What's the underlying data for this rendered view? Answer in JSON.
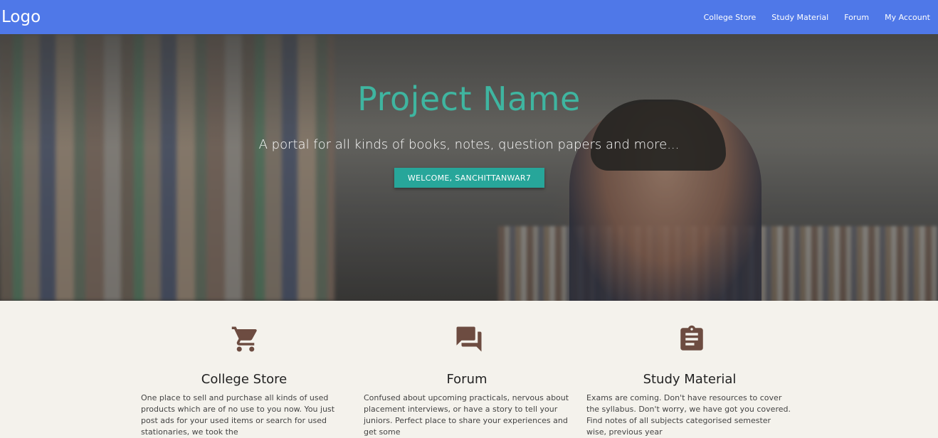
{
  "nav": {
    "logo": "Logo",
    "links": [
      "College Store",
      "Study Material",
      "Forum",
      "My Account"
    ]
  },
  "hero": {
    "title": "Project Name",
    "subtitle": "A portal for all kinds of books, notes, question papers and more...",
    "button": "WELCOME, SANCHITTANWAR7"
  },
  "features": [
    {
      "icon": "shopping-cart-icon",
      "title": "College Store",
      "text": "One place to sell and purchase all kinds of used products which are of no use to you now. You just post ads for your used items or search for used stationaries, we took the"
    },
    {
      "icon": "forum-chat-icon",
      "title": "Forum",
      "text": "Confused about upcoming practicals, nervous about placement interviews, or have a story to tell your juniors. Perfect place to share your experiences and get some"
    },
    {
      "icon": "clipboard-icon",
      "title": "Study Material",
      "text": "Exams are coming. Don't have resources to cover the syllabus. Don't worry, we have got you covered. Find notes of all subjects categorised semester wise, previous year"
    }
  ],
  "colors": {
    "navbar": "#4f78e8",
    "accent": "#27a69a",
    "title": "#3fb5a0",
    "icon": "#6d4c41"
  }
}
